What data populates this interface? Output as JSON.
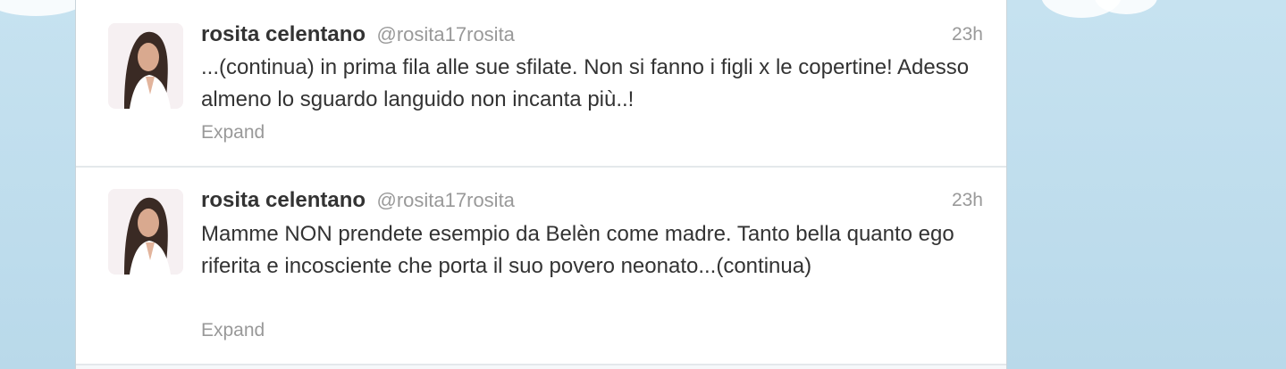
{
  "tweets": [
    {
      "fullname": "rosita celentano",
      "username": "@rosita17rosita",
      "time": "23h",
      "text": "...(continua) in prima fila alle sue sfilate. Non si fanno i figli x le copertine! Adesso almeno lo sguardo languido non incanta più..!",
      "expand": "Expand"
    },
    {
      "fullname": "rosita celentano",
      "username": "@rosita17rosita",
      "time": "23h",
      "text": "Mamme NON prendete esempio da Belèn come madre. Tanto bella quanto ego riferita e incosciente che porta il suo povero neonato...(continua)",
      "expand": "Expand"
    }
  ],
  "colors": {
    "background": "#c0deed",
    "name": "#333333",
    "meta": "#999999",
    "divider": "#e4e8eb"
  }
}
